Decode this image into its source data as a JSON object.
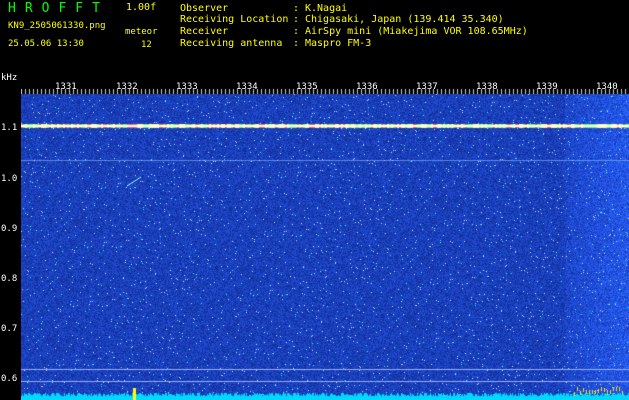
{
  "header": {
    "brand": "HROFFT",
    "version": "1.00f",
    "filename": "KN9_2505061330.png",
    "datetime": "25.05.06 13:30",
    "meteor_label": "meteor",
    "meteor_count": "12",
    "meta": [
      {
        "key": "Observer",
        "value": "K.Nagai"
      },
      {
        "key": "Receiving Location",
        "value": "Chigasaki, Japan (139.414 35.340)"
      },
      {
        "key": "Receiver",
        "value": "AirSpy mini (Miakejima VOR 108.65MHz)"
      },
      {
        "key": "Receiving antenna",
        "value": "Maspro FM-3"
      }
    ],
    "sep": ":"
  },
  "axis": {
    "y_unit": "kHz",
    "y_ticks": [
      "1.1",
      "1.0",
      "0.9",
      "0.8",
      "0.7",
      "0.6"
    ],
    "x_ticks": [
      "1331",
      "1332",
      "1333",
      "1334",
      "1335",
      "1336",
      "1337",
      "1338",
      "1339",
      "1340"
    ]
  },
  "colors": {
    "background": "#000000",
    "waterfall_base": "#0a1a6e",
    "carrier": "#ffffff",
    "label_yellow": "#ffff00",
    "label_green": "#00ff00"
  }
}
